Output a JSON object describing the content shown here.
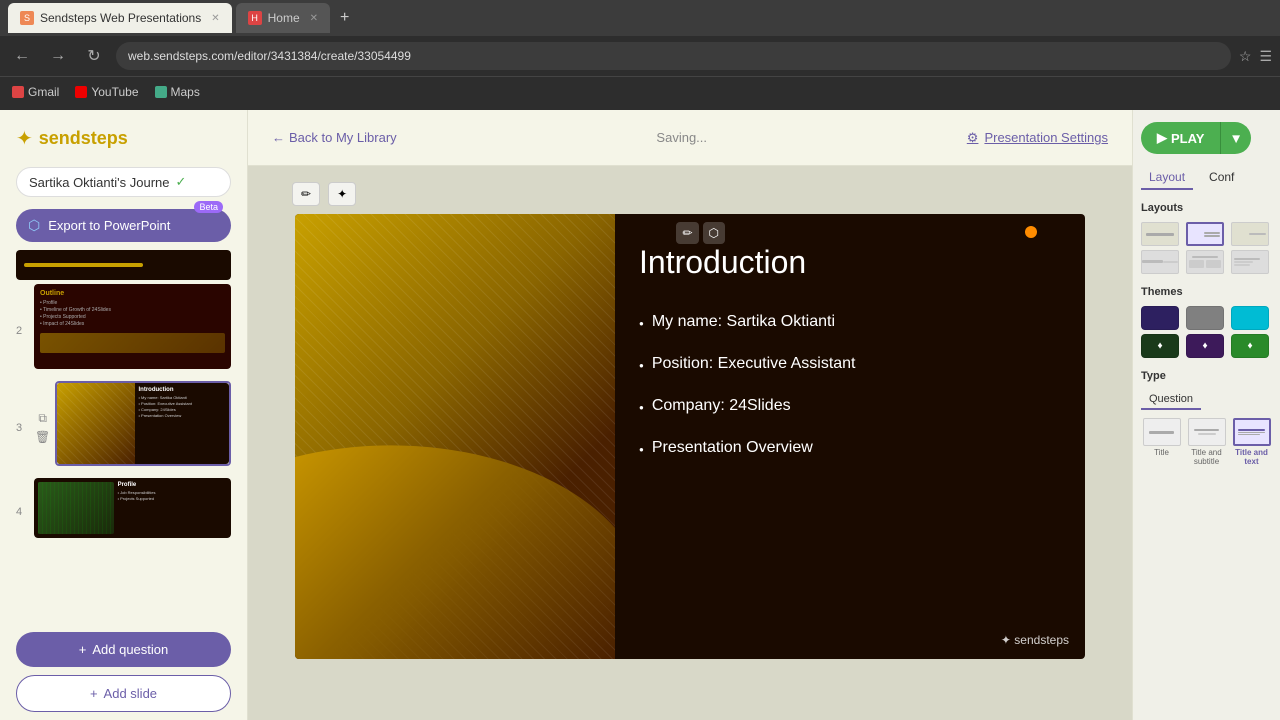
{
  "browser": {
    "tabs": [
      {
        "id": "sendsteps",
        "title": "Sendsteps Web Presentations",
        "active": true,
        "favicon_color": "#e85"
      },
      {
        "id": "home",
        "title": "Home",
        "active": false,
        "favicon_color": "#d44"
      }
    ],
    "url": "web.sendsteps.com/editor/3431384/create/33054499",
    "bookmarks": [
      {
        "id": "gmail",
        "label": "Gmail",
        "color": "#d44"
      },
      {
        "id": "youtube",
        "label": "YouTube",
        "color": "#e00"
      },
      {
        "id": "maps",
        "label": "Maps",
        "color": "#4a8"
      }
    ]
  },
  "app": {
    "logo": "sendsteps",
    "presentation_title": "Sartika Oktianti's Journe",
    "export_btn_label": "Export to PowerPoint",
    "beta_label": "Beta",
    "saving_text": "Saving...",
    "back_label": "Back to My Library",
    "settings_label": "Presentation Settings",
    "play_label": "PLAY",
    "slides": [
      {
        "number": "",
        "id": "slide-1"
      },
      {
        "number": "2",
        "id": "slide-2"
      },
      {
        "number": "3",
        "id": "slide-3"
      },
      {
        "number": "4",
        "id": "slide-4"
      }
    ],
    "add_question_label": "Add question",
    "add_slide_label": "Add slide"
  },
  "slide": {
    "title": "Introduction",
    "bullets": [
      "My name: Sartika Oktianti",
      "Position: Executive Assistant",
      "Company: 24Slides",
      "Presentation Overview"
    ],
    "logo_text": "sendsteps"
  },
  "right_panel": {
    "tabs": [
      "Layout",
      "Conf"
    ],
    "active_tab": "Layout",
    "layout_section": "Layouts",
    "themes_section": "Themes",
    "type_section": "Type",
    "type_tabs": [
      "Question",
      ""
    ],
    "themes": [
      {
        "id": "dark-purple",
        "color": "#2d2060"
      },
      {
        "id": "gray",
        "color": "#808080"
      },
      {
        "id": "teal",
        "color": "#00bcd4"
      },
      {
        "id": "dark-green",
        "color": "#1a3a1a"
      },
      {
        "id": "dark-purple2",
        "color": "#3d1a5a"
      },
      {
        "id": "bright-green",
        "color": "#2a8a2a"
      }
    ],
    "slide_types": [
      {
        "id": "title",
        "label": "Title"
      },
      {
        "id": "title-subtitle",
        "label": "Title and subtitle"
      },
      {
        "id": "title-text",
        "label": "Title and text",
        "selected": true
      }
    ]
  }
}
